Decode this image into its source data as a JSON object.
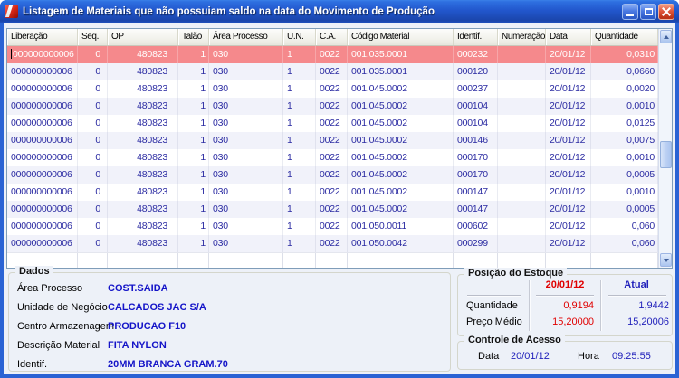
{
  "window": {
    "title": "Listagem de Materiais que não possuiam saldo na data do Movimento de Produção"
  },
  "icons": {
    "app_icon": "red-swoosh-app-icon",
    "minimize": "minimize-icon",
    "maximize": "maximize-icon",
    "close": "close-icon",
    "scroll_up": "chevron-up-icon",
    "scroll_down": "chevron-down-icon"
  },
  "table": {
    "columns": [
      "Liberação",
      "Seq.",
      "OP",
      "Talão",
      "Área Processo",
      "U.N.",
      "C.A.",
      "Código Material",
      "Identif.",
      "Numeração",
      "Data",
      "Quantidade"
    ],
    "selected_row_index": 0,
    "rows": [
      [
        "000000000006",
        "0",
        "480823",
        "1",
        "030",
        "1",
        "0022",
        "001.035.0001",
        "000232",
        "",
        "20/01/12",
        "0,0310"
      ],
      [
        "000000000006",
        "0",
        "480823",
        "1",
        "030",
        "1",
        "0022",
        "001.035.0001",
        "000120",
        "",
        "20/01/12",
        "0,0660"
      ],
      [
        "000000000006",
        "0",
        "480823",
        "1",
        "030",
        "1",
        "0022",
        "001.045.0002",
        "000237",
        "",
        "20/01/12",
        "0,0020"
      ],
      [
        "000000000006",
        "0",
        "480823",
        "1",
        "030",
        "1",
        "0022",
        "001.045.0002",
        "000104",
        "",
        "20/01/12",
        "0,0010"
      ],
      [
        "000000000006",
        "0",
        "480823",
        "1",
        "030",
        "1",
        "0022",
        "001.045.0002",
        "000104",
        "",
        "20/01/12",
        "0,0125"
      ],
      [
        "000000000006",
        "0",
        "480823",
        "1",
        "030",
        "1",
        "0022",
        "001.045.0002",
        "000146",
        "",
        "20/01/12",
        "0,0075"
      ],
      [
        "000000000006",
        "0",
        "480823",
        "1",
        "030",
        "1",
        "0022",
        "001.045.0002",
        "000170",
        "",
        "20/01/12",
        "0,0010"
      ],
      [
        "000000000006",
        "0",
        "480823",
        "1",
        "030",
        "1",
        "0022",
        "001.045.0002",
        "000170",
        "",
        "20/01/12",
        "0,0005"
      ],
      [
        "000000000006",
        "0",
        "480823",
        "1",
        "030",
        "1",
        "0022",
        "001.045.0002",
        "000147",
        "",
        "20/01/12",
        "0,0010"
      ],
      [
        "000000000006",
        "0",
        "480823",
        "1",
        "030",
        "1",
        "0022",
        "001.045.0002",
        "000147",
        "",
        "20/01/12",
        "0,0005"
      ],
      [
        "000000000006",
        "0",
        "480823",
        "1",
        "030",
        "1",
        "0022",
        "001.050.0011",
        "000602",
        "",
        "20/01/12",
        "0,060"
      ],
      [
        "000000000006",
        "0",
        "480823",
        "1",
        "030",
        "1",
        "0022",
        "001.050.0042",
        "000299",
        "",
        "20/01/12",
        "0,060"
      ]
    ]
  },
  "dados": {
    "title": "Dados",
    "fields": [
      {
        "label": "Área Processo",
        "value": "COST.SAIDA"
      },
      {
        "label": "Unidade de Negócio",
        "value": "CALCADOS JAC S/A"
      },
      {
        "label": "Centro Armazenagem",
        "value": "PRODUCAO F10"
      },
      {
        "label": "Descrição Material",
        "value": "FITA NYLON"
      },
      {
        "label": "Identif.",
        "value": "20MM BRANCA GRAM.70"
      }
    ]
  },
  "posicao_estoque": {
    "title": "Posição do Estoque",
    "date_header": "20/01/12",
    "atual_header": "Atual",
    "rows": [
      {
        "label": "Quantidade",
        "date_value": "0,9194",
        "atual_value": "1,9442"
      },
      {
        "label": "Preço Médio",
        "date_value": "15,20000",
        "atual_value": "15,20006"
      }
    ]
  },
  "controle_acesso": {
    "title": "Controle de Acesso",
    "data_label": "Data",
    "data_value": "20/01/12",
    "hora_label": "Hora",
    "hora_value": "09:25:55"
  },
  "colors": {
    "selected_row": "#F5898C",
    "selected_row_text": "#FFFFFF",
    "grid_text": "#2B2BA2",
    "date_column_red": "#E00000",
    "atual_column_navy": "#2222BB",
    "titlebar_blue": "#2257CD"
  }
}
